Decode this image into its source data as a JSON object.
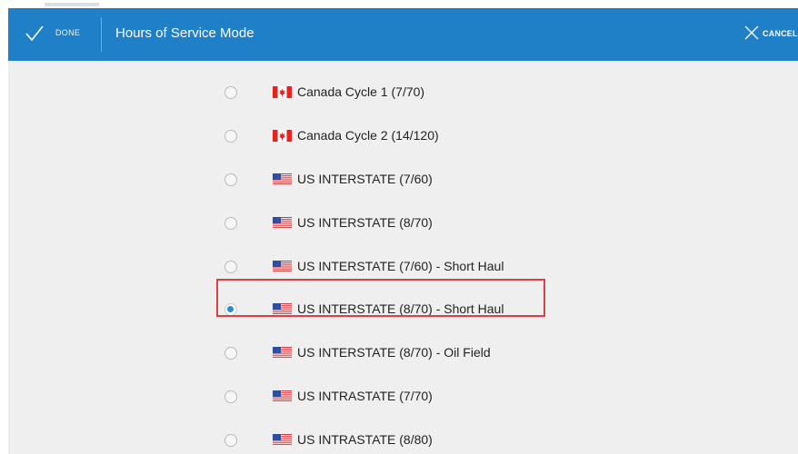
{
  "header": {
    "done_label": "DONE",
    "title": "Hours of Service Mode",
    "cancel_label": "CANCEL"
  },
  "options": [
    {
      "label": "Canada Cycle 1 (7/70)",
      "flag": "canada",
      "selected": false
    },
    {
      "label": "Canada Cycle 2 (14/120)",
      "flag": "canada",
      "selected": false
    },
    {
      "label": "US INTERSTATE (7/60)",
      "flag": "us",
      "selected": false
    },
    {
      "label": "US INTERSTATE (8/70)",
      "flag": "us",
      "selected": false
    },
    {
      "label": "US INTERSTATE (7/60) - Short Haul",
      "flag": "us",
      "selected": false
    },
    {
      "label": "US INTERSTATE (8/70) - Short Haul",
      "flag": "us",
      "selected": true
    },
    {
      "label": "US INTERSTATE (8/70) - Oil Field",
      "flag": "us",
      "selected": false
    },
    {
      "label": "US INTRASTATE (7/70)",
      "flag": "us",
      "selected": false
    },
    {
      "label": "US INTRASTATE (8/80)",
      "flag": "us",
      "selected": false
    }
  ],
  "colors": {
    "header_bg": "#1f7fc7",
    "radio_selected": "#1f8fd8",
    "highlight_border": "#e0403d",
    "page_bg": "#efefef"
  },
  "icons": {
    "done": "checkmark-icon",
    "cancel": "close-icon",
    "canada_flag": "canada-flag-icon",
    "us_flag": "us-flag-icon"
  }
}
